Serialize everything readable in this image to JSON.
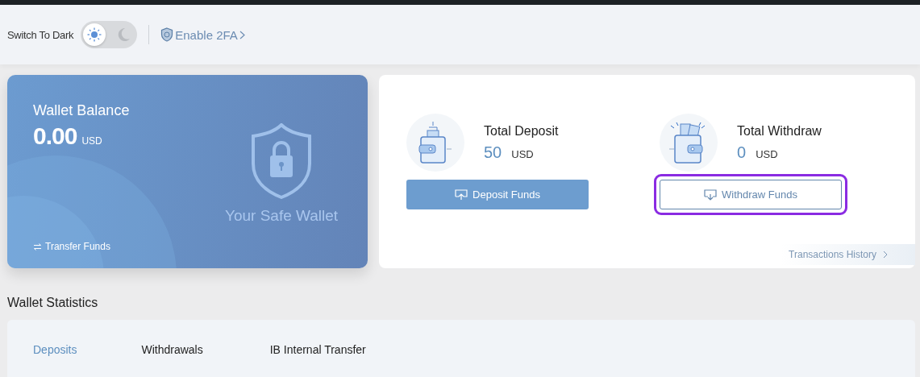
{
  "header": {
    "theme_label": "Switch To Dark",
    "dark_mode": false,
    "twofa_link": "Enable 2FA"
  },
  "wallet_card": {
    "title": "Wallet Balance",
    "amount": "0.00",
    "currency": "USD",
    "tagline": "Your Safe Wallet",
    "transfer_link": "Transfer Funds"
  },
  "totals": [
    {
      "kind": "deposit",
      "title": "Total Deposit",
      "amount": "50",
      "currency": "USD",
      "button": "Deposit Funds",
      "highlighted": false
    },
    {
      "kind": "withdraw",
      "title": "Total Withdraw",
      "amount": "0",
      "currency": "USD",
      "button": "Withdraw Funds",
      "highlighted": true
    }
  ],
  "history_link": "Transactions History",
  "statistics": {
    "title": "Wallet Statistics",
    "tabs": [
      {
        "label": "Deposits",
        "selected": true
      },
      {
        "label": "Withdrawals",
        "selected": false
      },
      {
        "label": "IB Internal Transfer",
        "selected": false
      }
    ]
  }
}
